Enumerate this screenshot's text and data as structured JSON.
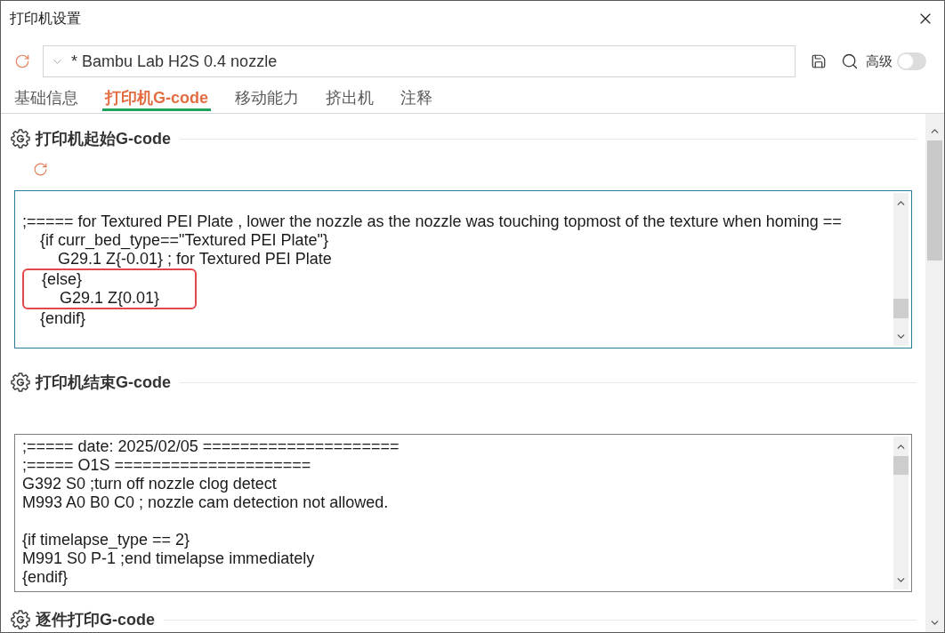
{
  "window": {
    "title": "打印机设置"
  },
  "preset": {
    "value": "* Bambu Lab H2S 0.4 nozzle",
    "modified": true
  },
  "advanced": {
    "label": "高级",
    "on": false
  },
  "tabs": [
    {
      "label": "基础信息",
      "selected": false
    },
    {
      "label": "打印机G-code",
      "selected": true
    },
    {
      "label": "移动能力",
      "selected": false
    },
    {
      "label": "挤出机",
      "selected": false
    },
    {
      "label": "注释",
      "selected": false
    }
  ],
  "sections": [
    {
      "title": "打印机起始G-code",
      "modified": true,
      "editor": {
        "focused": true,
        "lines": [
          {
            "kind": "blank"
          },
          {
            "kind": "code",
            "text": ";===== for Textured PEI Plate , lower the nozzle as the nozzle was touching topmost of the texture when homing ==",
            "highlighted": false
          },
          {
            "kind": "code",
            "text": "    {if curr_bed_type==\"Textured PEI Plate\"}",
            "highlighted": false
          },
          {
            "kind": "code",
            "text": "        G29.1 Z{-0.01} ; for Textured PEI Plate",
            "highlighted": false
          },
          {
            "kind": "code",
            "text": "    {else}",
            "highlighted": true
          },
          {
            "kind": "code",
            "text": "        G29.1 Z{0.01}",
            "highlighted": true
          },
          {
            "kind": "code",
            "text": "    {endif}",
            "highlighted": false
          }
        ]
      }
    },
    {
      "title": "打印机结束G-code",
      "modified": false,
      "editor": {
        "focused": false,
        "lines": [
          {
            "kind": "code",
            "text": ";===== date: 2025/02/05 ====================="
          },
          {
            "kind": "code",
            "text": ";===== O1S ====================="
          },
          {
            "kind": "code",
            "text": "G392 S0 ;turn off nozzle clog detect"
          },
          {
            "kind": "code",
            "text": "M993 A0 B0 C0 ; nozzle cam detection not allowed."
          },
          {
            "kind": "blank"
          },
          {
            "kind": "code",
            "text": "{if timelapse_type == 2}"
          },
          {
            "kind": "code",
            "text": "M991 S0 P-1 ;end timelapse immediately"
          },
          {
            "kind": "code",
            "text": "{endif}"
          }
        ]
      }
    },
    {
      "title": "逐件打印G-code"
    }
  ]
}
